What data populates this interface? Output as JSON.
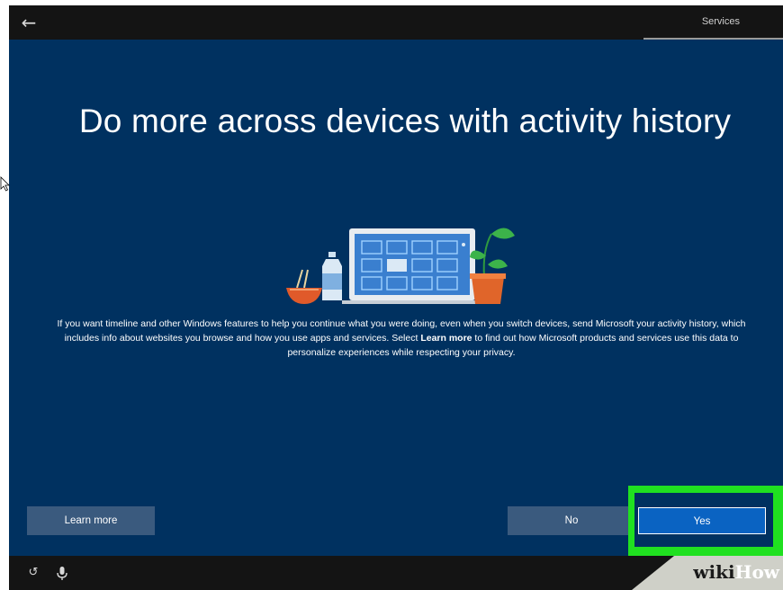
{
  "topbar": {
    "back_icon": "back-arrow-icon",
    "step_label": "Services"
  },
  "title": "Do more across devices with activity history",
  "body": {
    "text_before": "If you want timeline and other Windows features to help you continue what you were doing, even when you switch devices, send Microsoft your activity history, which includes info about websites you browse and how you use apps and services. Select ",
    "bold_link": "Learn more",
    "text_after": " to find out how Microsoft products and services use this data to personalize experiences while respecting your privacy."
  },
  "buttons": {
    "learn_more": "Learn more",
    "no": "No",
    "yes": "Yes"
  },
  "bottombar": {
    "icons": [
      "accessibility-icon",
      "microphone-icon"
    ]
  },
  "watermark": {
    "text": "wikiHow",
    "prefix": "wiki",
    "suffix": "How"
  },
  "colors": {
    "background": "#003160",
    "yes_button": "#0a63c2",
    "highlight": "#20e020",
    "secondary_button": "#3a5a7e"
  }
}
